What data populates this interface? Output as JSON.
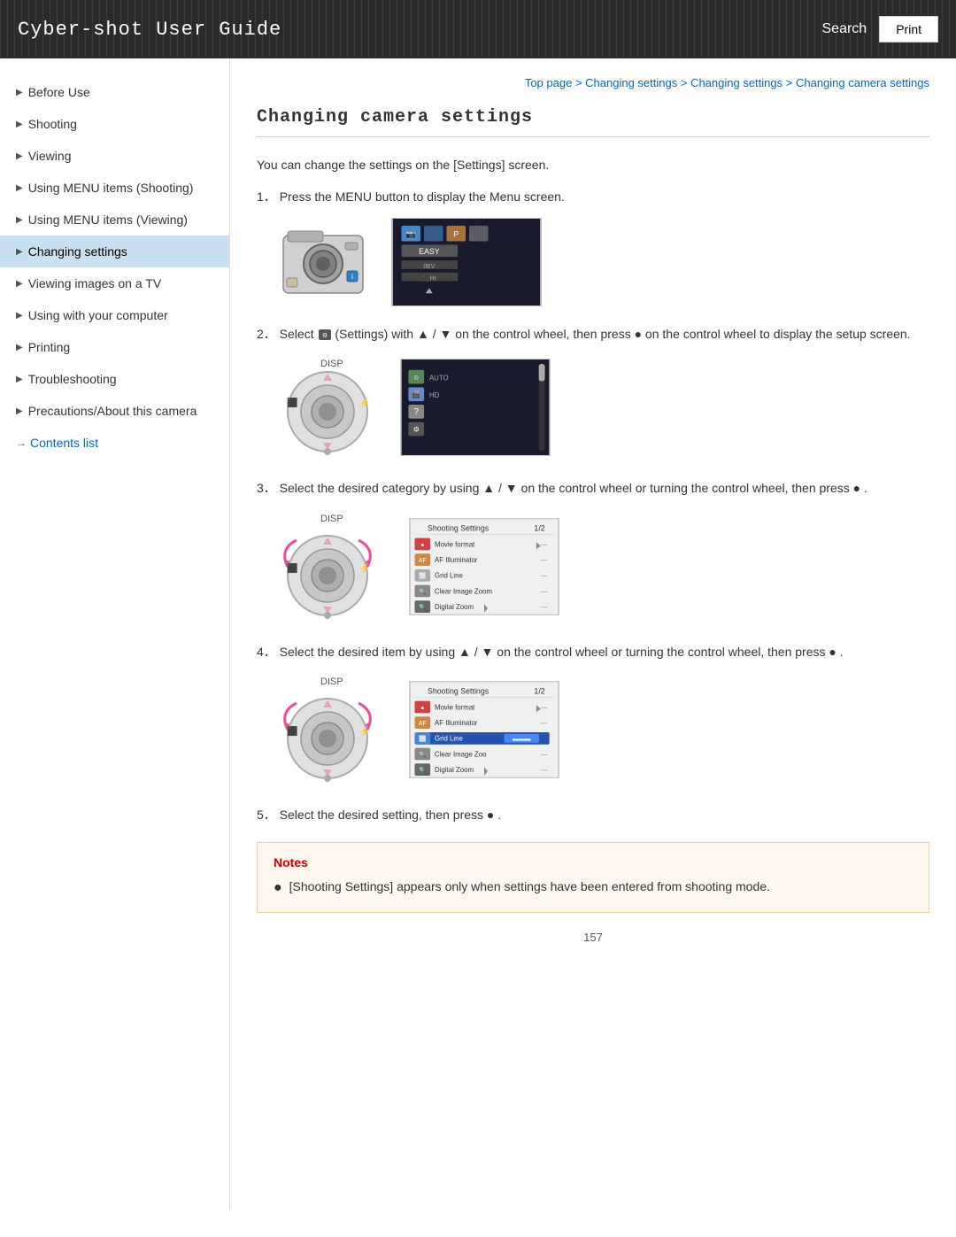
{
  "header": {
    "title": "Cyber-shot User Guide",
    "search_label": "Search",
    "print_label": "Print"
  },
  "breadcrumb": {
    "items": [
      "Top page",
      "Changing settings",
      "Changing settings",
      "Changing camera settings"
    ],
    "separator": " > "
  },
  "page": {
    "title": "Changing camera settings",
    "intro": "You can change the settings on the [Settings] screen."
  },
  "steps": [
    {
      "number": "1",
      "text": "Press the MENU button to display the Menu screen."
    },
    {
      "number": "2",
      "text": "Select  (Settings) with  ▲ / ▼  on the control wheel, then press  ●  on the control wheel to display the setup screen."
    },
    {
      "number": "3",
      "text": "Select the desired category by using  ▲ / ▼  on the control wheel or turning the control wheel, then press  ● ."
    },
    {
      "number": "4",
      "text": "Select the desired item by using  ▲ / ▼  on the control wheel or turning the control wheel, then press  ● ."
    },
    {
      "number": "5",
      "text": "Select the desired setting, then press  ● ."
    }
  ],
  "notes": {
    "title": "Notes",
    "items": [
      "[Shooting Settings] appears only when settings have been entered from shooting mode."
    ]
  },
  "page_number": "157",
  "sidebar": {
    "items": [
      {
        "label": "Before Use",
        "active": false
      },
      {
        "label": "Shooting",
        "active": false
      },
      {
        "label": "Viewing",
        "active": false
      },
      {
        "label": "Using MENU items (Shooting)",
        "active": false
      },
      {
        "label": "Using MENU items (Viewing)",
        "active": false
      },
      {
        "label": "Changing settings",
        "active": true
      },
      {
        "label": "Viewing images on a TV",
        "active": false
      },
      {
        "label": "Using with your computer",
        "active": false
      },
      {
        "label": "Printing",
        "active": false
      },
      {
        "label": "Troubleshooting",
        "active": false
      },
      {
        "label": "Precautions/About this camera",
        "active": false
      }
    ],
    "contents_link": "Contents list"
  }
}
